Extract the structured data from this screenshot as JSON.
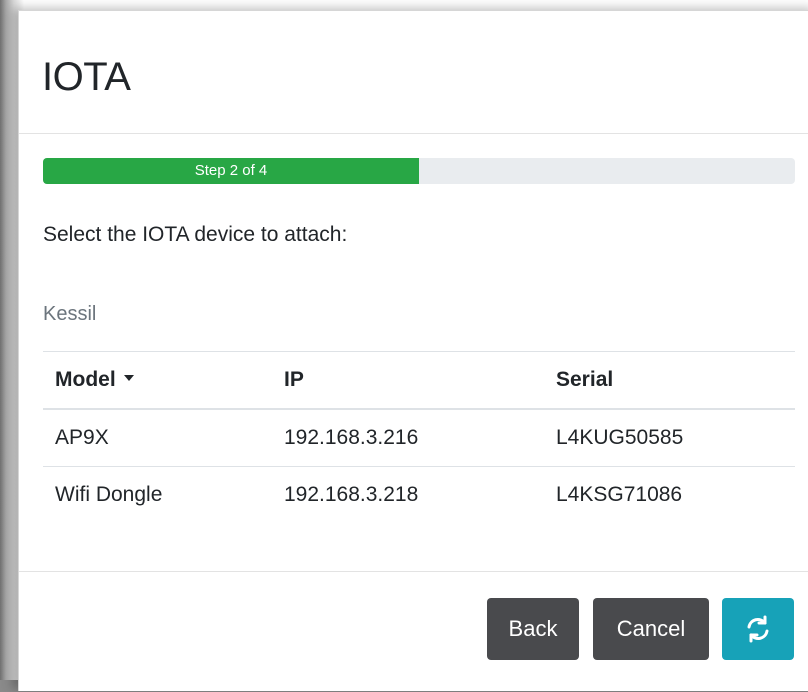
{
  "modal": {
    "title": "IOTA"
  },
  "progress": {
    "label": "Step 2 of 4",
    "value": 0.5,
    "color": "#28a745"
  },
  "prompt": "Select the IOTA device to attach:",
  "group": {
    "label": "Kessil"
  },
  "table": {
    "headers": {
      "model": "Model",
      "ip": "IP",
      "serial": "Serial"
    },
    "sort_indicator": "caret-down-icon",
    "rows": [
      {
        "model": "AP9X",
        "ip": "192.168.3.216",
        "serial": "L4KUG50585"
      },
      {
        "model": "Wifi Dongle",
        "ip": "192.168.3.218",
        "serial": "L4KSG71086"
      }
    ]
  },
  "footer": {
    "back_label": "Back",
    "cancel_label": "Cancel",
    "refresh_icon": "refresh-icon"
  },
  "colors": {
    "secondary_button": "#494a4d",
    "info_button": "#17a2b8",
    "progress_track": "#e9ecef"
  }
}
